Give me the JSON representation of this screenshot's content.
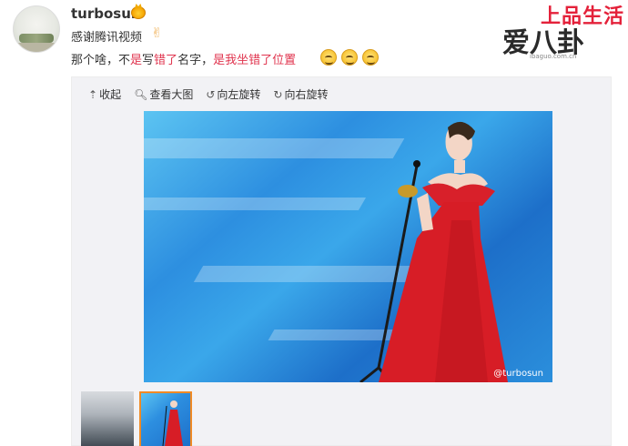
{
  "post": {
    "username": "turbosun",
    "line1": "感谢腾讯视频",
    "line2_parts": [
      "那个啥，不",
      "是",
      "写",
      "错了",
      "名字，",
      "是我坐错了位置"
    ]
  },
  "watermark": {
    "top": "上品生活",
    "mid": "爱八卦",
    "url": "ibaguo.com.cn"
  },
  "toolbar": {
    "collapse_label": "收起",
    "view_large_label": "查看大图",
    "rotate_left_label": "向左旋转",
    "rotate_right_label": "向右旋转"
  },
  "image": {
    "caption": "@turbosun"
  },
  "icons": [
    "crown-badge-icon",
    "victory-hand-icon",
    "grin-emoji-icon",
    "collapse-arrow-icon",
    "magnifier-icon",
    "rotate-left-icon",
    "rotate-right-icon"
  ],
  "colors": {
    "highlight_red": "#e0344e",
    "watermark_red": "#e4213a",
    "thumb_selected": "#f08a24"
  }
}
